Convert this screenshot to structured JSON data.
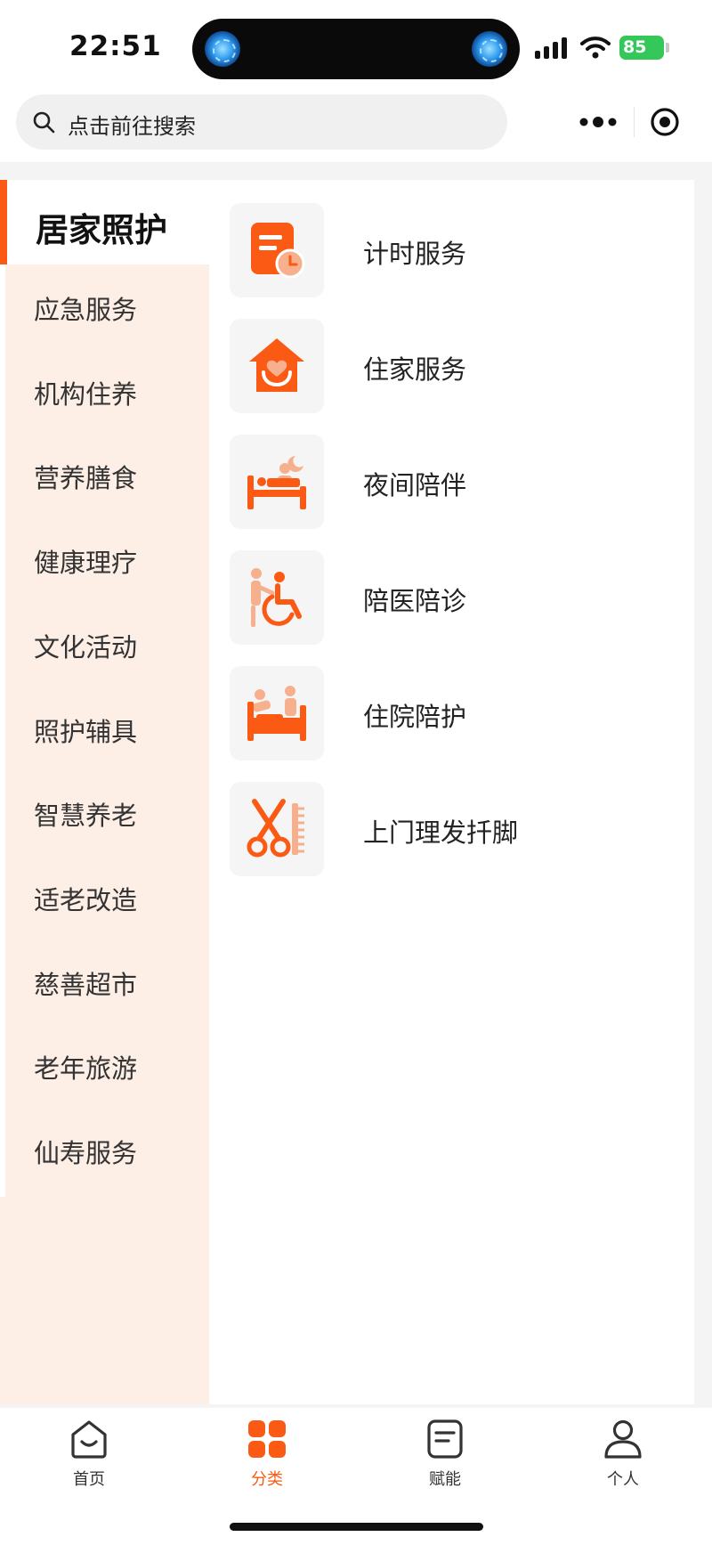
{
  "status_bar": {
    "time": "22:51",
    "battery": "85",
    "icons": [
      "signal-icon",
      "wifi-icon",
      "battery-icon"
    ]
  },
  "search": {
    "placeholder": "点击前往搜索"
  },
  "sidebar": {
    "active": "居家照护",
    "items": [
      "应急服务",
      "机构住养",
      "营养膳食",
      "健康理疗",
      "文化活动",
      "照护辅具",
      "智慧养老",
      "适老改造",
      "慈善超市",
      "老年旅游",
      "仙寿服务"
    ]
  },
  "services": [
    {
      "label": "计时服务",
      "icon": "timed-service-icon"
    },
    {
      "label": "住家服务",
      "icon": "home-care-icon"
    },
    {
      "label": "夜间陪伴",
      "icon": "night-companion-icon"
    },
    {
      "label": "陪医陪诊",
      "icon": "hospital-escort-icon"
    },
    {
      "label": "住院陪护",
      "icon": "inpatient-care-icon"
    },
    {
      "label": "上门理发扦脚",
      "icon": "haircut-pedicure-icon"
    }
  ],
  "tabs": [
    {
      "label": "首页",
      "icon": "home-icon"
    },
    {
      "label": "分类",
      "icon": "category-icon",
      "active": true
    },
    {
      "label": "赋能",
      "icon": "empower-icon"
    },
    {
      "label": "个人",
      "icon": "profile-icon"
    }
  ],
  "colors": {
    "accent": "#fa5a14",
    "sidebar_bg": "#fdeee6",
    "icon_light": "#f6b08e"
  }
}
